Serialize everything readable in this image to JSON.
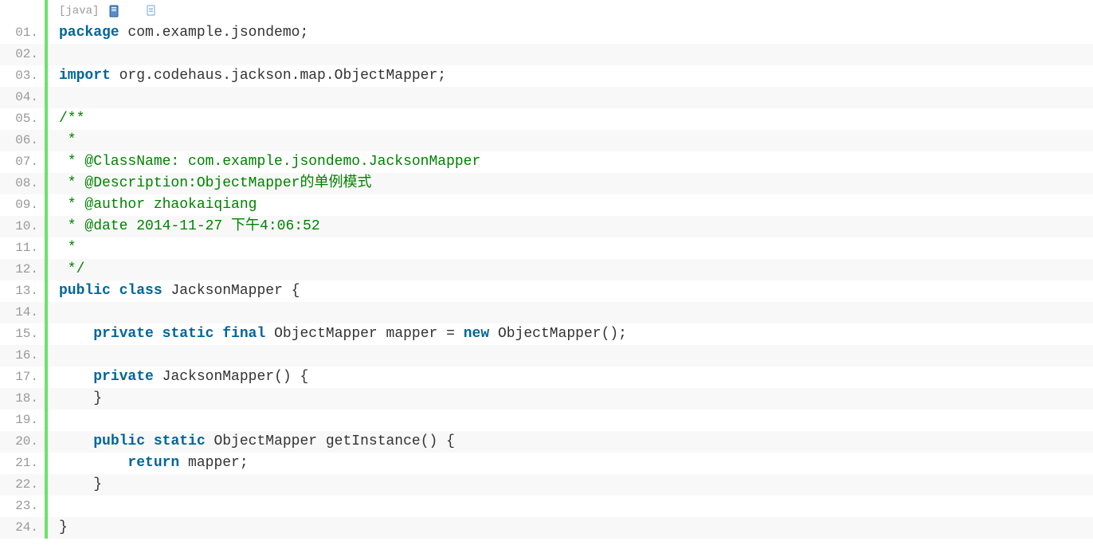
{
  "toolbar": {
    "lang": "[java]"
  },
  "code": {
    "lines": [
      [
        {
          "t": "kw",
          "s": "package"
        },
        {
          "t": "pln",
          "s": " com.example.jsondemo;"
        }
      ],
      [],
      [
        {
          "t": "kw",
          "s": "import"
        },
        {
          "t": "pln",
          "s": " org.codehaus.jackson.map.ObjectMapper;"
        }
      ],
      [],
      [
        {
          "t": "comment",
          "s": "/**"
        }
      ],
      [
        {
          "t": "comment",
          "s": " *"
        }
      ],
      [
        {
          "t": "comment",
          "s": " * @ClassName: com.example.jsondemo.JacksonMapper"
        }
      ],
      [
        {
          "t": "comment",
          "s": " * @Description:ObjectMapper的单例模式"
        }
      ],
      [
        {
          "t": "comment",
          "s": " * @author zhaokaiqiang"
        }
      ],
      [
        {
          "t": "comment",
          "s": " * @date 2014-11-27 下午4:06:52"
        }
      ],
      [
        {
          "t": "comment",
          "s": " *"
        }
      ],
      [
        {
          "t": "comment",
          "s": " */"
        }
      ],
      [
        {
          "t": "kw",
          "s": "public"
        },
        {
          "t": "pln",
          "s": " "
        },
        {
          "t": "kw",
          "s": "class"
        },
        {
          "t": "pln",
          "s": " JacksonMapper {"
        }
      ],
      [],
      [
        {
          "t": "pln",
          "s": "    "
        },
        {
          "t": "kw",
          "s": "private"
        },
        {
          "t": "pln",
          "s": " "
        },
        {
          "t": "kw",
          "s": "static"
        },
        {
          "t": "pln",
          "s": " "
        },
        {
          "t": "kw",
          "s": "final"
        },
        {
          "t": "pln",
          "s": " ObjectMapper mapper = "
        },
        {
          "t": "kw",
          "s": "new"
        },
        {
          "t": "pln",
          "s": " ObjectMapper();"
        }
      ],
      [],
      [
        {
          "t": "pln",
          "s": "    "
        },
        {
          "t": "kw",
          "s": "private"
        },
        {
          "t": "pln",
          "s": " JacksonMapper() {"
        }
      ],
      [
        {
          "t": "pln",
          "s": "    }"
        }
      ],
      [],
      [
        {
          "t": "pln",
          "s": "    "
        },
        {
          "t": "kw",
          "s": "public"
        },
        {
          "t": "pln",
          "s": " "
        },
        {
          "t": "kw",
          "s": "static"
        },
        {
          "t": "pln",
          "s": " ObjectMapper getInstance() {"
        }
      ],
      [
        {
          "t": "pln",
          "s": "        "
        },
        {
          "t": "kw",
          "s": "return"
        },
        {
          "t": "pln",
          "s": " mapper;"
        }
      ],
      [
        {
          "t": "pln",
          "s": "    }"
        }
      ],
      [],
      [
        {
          "t": "pln",
          "s": "}"
        }
      ]
    ],
    "numbers": [
      "01.",
      "02.",
      "03.",
      "04.",
      "05.",
      "06.",
      "07.",
      "08.",
      "09.",
      "10.",
      "11.",
      "12.",
      "13.",
      "14.",
      "15.",
      "16.",
      "17.",
      "18.",
      "19.",
      "20.",
      "21.",
      "22.",
      "23.",
      "24."
    ]
  }
}
